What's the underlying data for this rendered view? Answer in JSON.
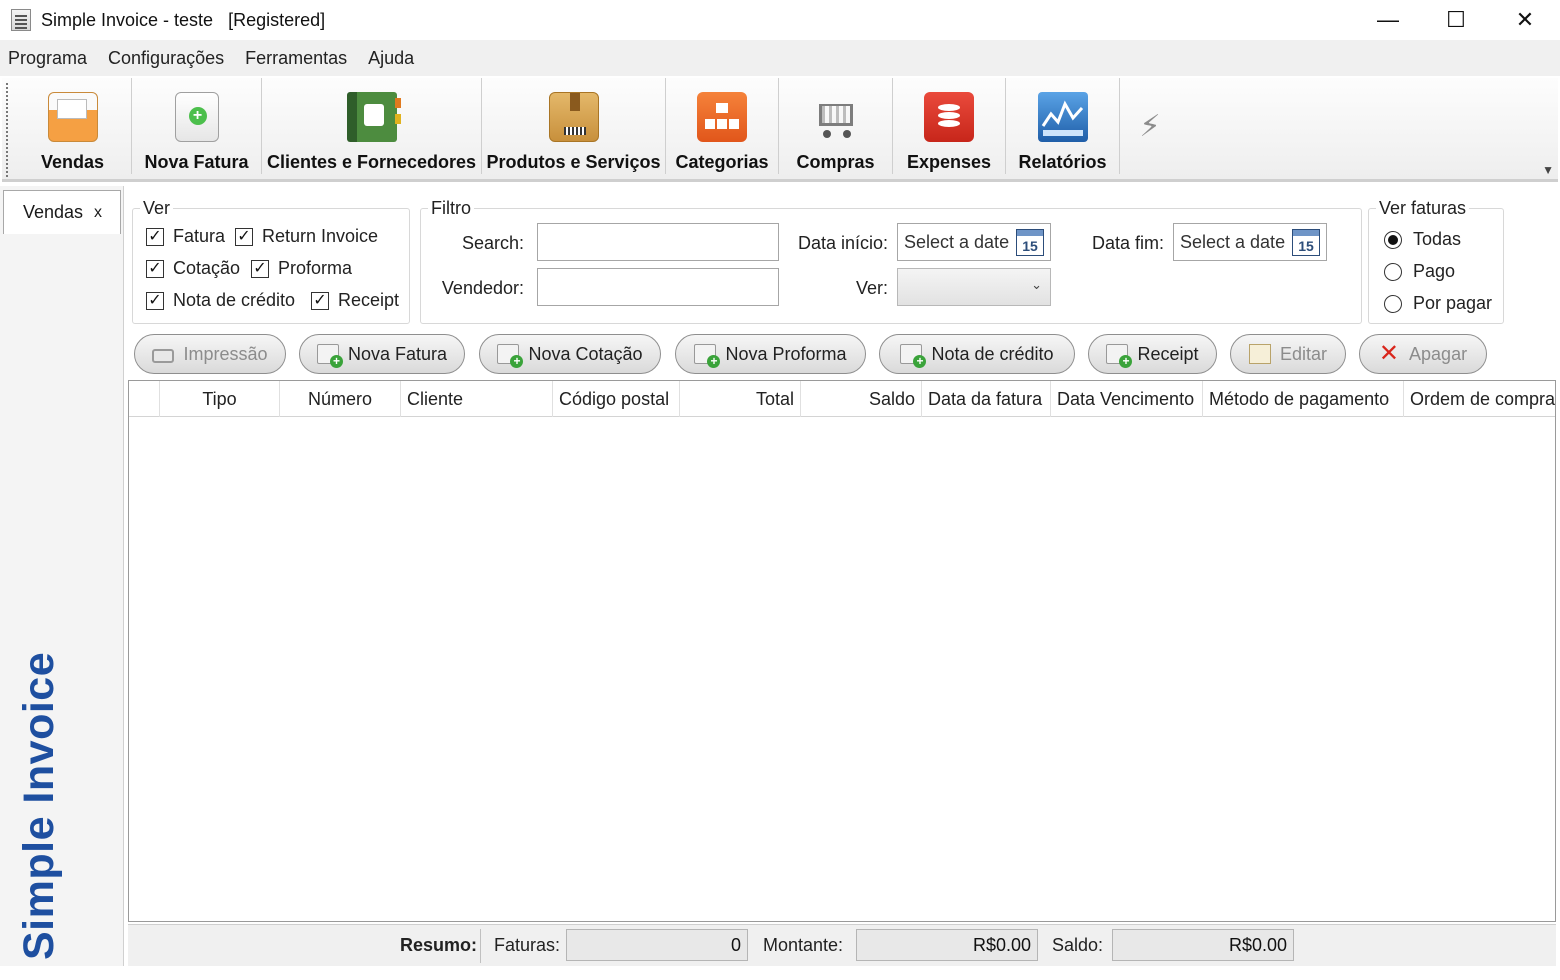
{
  "window": {
    "title": "Simple Invoice - teste   [Registered]",
    "minimize": "—",
    "maximize": "☐",
    "close": "✕"
  },
  "menu": [
    "Programa",
    "Configurações",
    "Ferramentas",
    "Ajuda"
  ],
  "toolbar": {
    "items": [
      {
        "label": "Vendas",
        "icon": "sales-folder-icon"
      },
      {
        "label": "Nova Fatura",
        "icon": "new-invoice-icon"
      },
      {
        "label": "Clientes e Fornecedores",
        "icon": "address-book-icon"
      },
      {
        "label": "Produtos e Serviços",
        "icon": "product-box-icon"
      },
      {
        "label": "Categorias",
        "icon": "categories-hierarchy-icon"
      },
      {
        "label": "Compras",
        "icon": "shopping-cart-icon"
      },
      {
        "label": "Expenses",
        "icon": "coins-icon"
      },
      {
        "label": "Relatórios",
        "icon": "chart-report-icon"
      }
    ],
    "extra_icon": "lightning-icon"
  },
  "tabs": {
    "active": "Vendas",
    "close": "x"
  },
  "brand": "Simple Invoice",
  "ver_group": {
    "title": "Ver",
    "checkboxes": [
      {
        "label": "Fatura",
        "checked": true
      },
      {
        "label": "Return Invoice",
        "checked": true
      },
      {
        "label": "Cotação",
        "checked": true
      },
      {
        "label": "Proforma",
        "checked": true
      },
      {
        "label": "Nota de crédito",
        "checked": true
      },
      {
        "label": "Receipt",
        "checked": true
      }
    ]
  },
  "filtro": {
    "title": "Filtro",
    "search_label": "Search:",
    "search_value": "",
    "vendedor_label": "Vendedor:",
    "vendedor_value": "",
    "data_inicio_label": "Data início:",
    "data_inicio_placeholder": "Select a date",
    "data_fim_label": "Data fim:",
    "data_fim_placeholder": "Select a date",
    "calendar_day": "15",
    "ver_label": "Ver:",
    "ver_value": ""
  },
  "ver_faturas": {
    "title": "Ver faturas",
    "options": [
      {
        "label": "Todas",
        "selected": true
      },
      {
        "label": "Pago",
        "selected": false
      },
      {
        "label": "Por pagar",
        "selected": false
      }
    ]
  },
  "actions": [
    {
      "label": "Impressão",
      "enabled": false,
      "icon": "printer-icon"
    },
    {
      "label": "Nova Fatura",
      "enabled": true,
      "icon": "new-document-icon"
    },
    {
      "label": "Nova Cotação",
      "enabled": true,
      "icon": "new-document-icon"
    },
    {
      "label": "Nova Proforma",
      "enabled": true,
      "icon": "new-document-icon"
    },
    {
      "label": "Nota de crédito",
      "enabled": true,
      "icon": "new-document-icon"
    },
    {
      "label": "Receipt",
      "enabled": true,
      "icon": "new-document-icon"
    },
    {
      "label": "Editar",
      "enabled": false,
      "icon": "edit-icon"
    },
    {
      "label": "Apagar",
      "enabled": false,
      "icon": "delete-x-icon"
    }
  ],
  "grid": {
    "columns": [
      "Tipo",
      "Número",
      "Cliente",
      "Código postal",
      "Total",
      "Saldo",
      "Data da fatura",
      "Data Vencimento",
      "Método de pagamento",
      "Ordem de compra"
    ],
    "rows": []
  },
  "summary": {
    "resumo_label": "Resumo:",
    "faturas_label": "Faturas:",
    "faturas_value": "0",
    "montante_label": "Montante:",
    "montante_value": "R$0.00",
    "saldo_label": "Saldo:",
    "saldo_value": "R$0.00"
  },
  "colors": {
    "brand_blue": "#1e4fa0",
    "delete_red": "#d9261c",
    "add_green": "#3aa33a"
  }
}
